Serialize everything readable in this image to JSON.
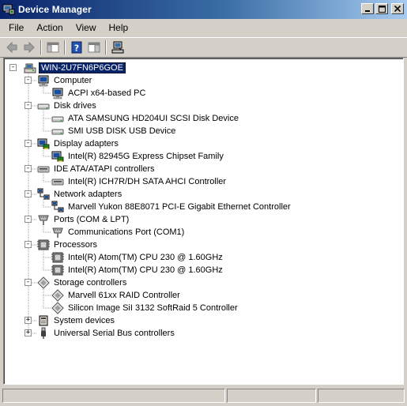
{
  "window": {
    "title": "Device Manager"
  },
  "menu": [
    "File",
    "Action",
    "View",
    "Help"
  ],
  "toolbar": [
    "back",
    "forward",
    "show-hide-console-tree",
    "help",
    "properties",
    "scan-hardware-changes"
  ],
  "tree": {
    "root": {
      "label": "WIN-2U7FN6P6GOE",
      "expanded": true,
      "selected": true
    },
    "categories": [
      {
        "label": "Computer",
        "icon": "computer-icon",
        "expanded": true,
        "children": [
          {
            "label": "ACPI x64-based PC",
            "icon": "computer-icon"
          }
        ]
      },
      {
        "label": "Disk drives",
        "icon": "disk-drive-icon",
        "expanded": true,
        "children": [
          {
            "label": "ATA SAMSUNG HD204UI SCSI Disk Device",
            "icon": "disk-drive-icon"
          },
          {
            "label": "SMI USB DISK USB Device",
            "icon": "disk-drive-icon"
          }
        ]
      },
      {
        "label": "Display adapters",
        "icon": "display-adapter-icon",
        "expanded": true,
        "children": [
          {
            "label": "Intel(R) 82945G Express Chipset Family",
            "icon": "display-adapter-icon"
          }
        ]
      },
      {
        "label": "IDE ATA/ATAPI controllers",
        "icon": "ide-controller-icon",
        "expanded": true,
        "children": [
          {
            "label": "Intel(R) ICH7R/DH SATA AHCI Controller",
            "icon": "ide-controller-icon"
          }
        ]
      },
      {
        "label": "Network adapters",
        "icon": "network-adapter-icon",
        "expanded": true,
        "children": [
          {
            "label": "Marvell Yukon 88E8071 PCI-E Gigabit Ethernet Controller",
            "icon": "network-adapter-icon"
          }
        ]
      },
      {
        "label": "Ports (COM & LPT)",
        "icon": "port-icon",
        "expanded": true,
        "children": [
          {
            "label": "Communications Port (COM1)",
            "icon": "port-icon"
          }
        ]
      },
      {
        "label": "Processors",
        "icon": "processor-icon",
        "expanded": true,
        "children": [
          {
            "label": "Intel(R) Atom(TM) CPU  230   @ 1.60GHz",
            "icon": "processor-icon"
          },
          {
            "label": "Intel(R) Atom(TM) CPU  230   @ 1.60GHz",
            "icon": "processor-icon"
          }
        ]
      },
      {
        "label": "Storage controllers",
        "icon": "storage-controller-icon",
        "expanded": true,
        "children": [
          {
            "label": "Marvell 61xx RAID Controller",
            "icon": "storage-controller-icon"
          },
          {
            "label": "Silicon Image SiI 3132 SoftRaid 5 Controller",
            "icon": "storage-controller-icon"
          }
        ]
      },
      {
        "label": "System devices",
        "icon": "system-devices-icon",
        "expanded": false,
        "children": []
      },
      {
        "label": "Universal Serial Bus controllers",
        "icon": "usb-icon",
        "expanded": false,
        "children": []
      }
    ]
  }
}
